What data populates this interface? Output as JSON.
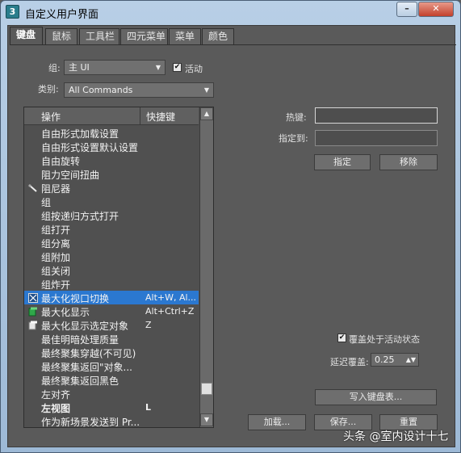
{
  "window": {
    "app_icon_label": "3",
    "title": "自定义用户界面",
    "minimize_label": "–",
    "close_label": "✕"
  },
  "tabs": [
    {
      "label": "键盘",
      "active": true
    },
    {
      "label": "鼠标",
      "active": false
    },
    {
      "label": "工具栏",
      "active": false
    },
    {
      "label": "四元菜单",
      "active": false
    },
    {
      "label": "菜单",
      "active": false
    },
    {
      "label": "颜色",
      "active": false
    }
  ],
  "group": {
    "label": "组:",
    "value": "主 UI",
    "active_label": "活动",
    "active_checked": true
  },
  "category": {
    "label": "类别:",
    "value": "All Commands"
  },
  "list": {
    "col_action": "操作",
    "col_shortcut": "快捷键",
    "rows": [
      {
        "name": "自由形式加载设置",
        "key": "",
        "icon": ""
      },
      {
        "name": "自由形式设置默认设置",
        "key": "",
        "icon": ""
      },
      {
        "name": "自由旋转",
        "key": "",
        "icon": ""
      },
      {
        "name": "阻力空间扭曲",
        "key": "",
        "icon": ""
      },
      {
        "name": "阻尼器",
        "key": "",
        "icon": "damper-icon"
      },
      {
        "name": "组",
        "key": "",
        "icon": ""
      },
      {
        "name": "组按递归方式打开",
        "key": "",
        "icon": ""
      },
      {
        "name": "组打开",
        "key": "",
        "icon": ""
      },
      {
        "name": "组分离",
        "key": "",
        "icon": ""
      },
      {
        "name": "组附加",
        "key": "",
        "icon": ""
      },
      {
        "name": "组关闭",
        "key": "",
        "icon": ""
      },
      {
        "name": "组炸开",
        "key": "",
        "icon": ""
      },
      {
        "name": "最大化视口切换",
        "key": "Alt+W, Al...",
        "icon": "maximize-viewport-icon",
        "selected": true
      },
      {
        "name": "最大化显示",
        "key": "Alt+Ctrl+Z",
        "icon": "zoom-extents-icon"
      },
      {
        "name": "最大化显示选定对象",
        "key": "Z",
        "icon": "zoom-selected-icon"
      },
      {
        "name": "最佳明暗处理质量",
        "key": "",
        "icon": ""
      },
      {
        "name": "最终聚集穿越(不可见)",
        "key": "",
        "icon": ""
      },
      {
        "name": "最终聚集返回\"对象...",
        "key": "",
        "icon": ""
      },
      {
        "name": "最终聚集返回黑色",
        "key": "",
        "icon": ""
      },
      {
        "name": "左对齐",
        "key": "",
        "icon": ""
      },
      {
        "name": "左视图",
        "key": "L",
        "icon": "",
        "bold": true
      },
      {
        "name": "作为新场景发送到 Pr...",
        "key": "",
        "icon": ""
      }
    ]
  },
  "hotkey": {
    "label": "热键:",
    "value": ""
  },
  "assigned_to": {
    "label": "指定到:",
    "value": ""
  },
  "buttons": {
    "assign": "指定",
    "remove": "移除",
    "write_keyboard_chart": "写入键盘表...",
    "load": "加载...",
    "save": "保存...",
    "reset": "重置"
  },
  "override": {
    "label": "覆盖处于活动状态",
    "checked": true
  },
  "delay_override": {
    "label": "延迟覆盖:",
    "value": "0.25"
  },
  "watermark": "头条 @室内设计十七"
}
